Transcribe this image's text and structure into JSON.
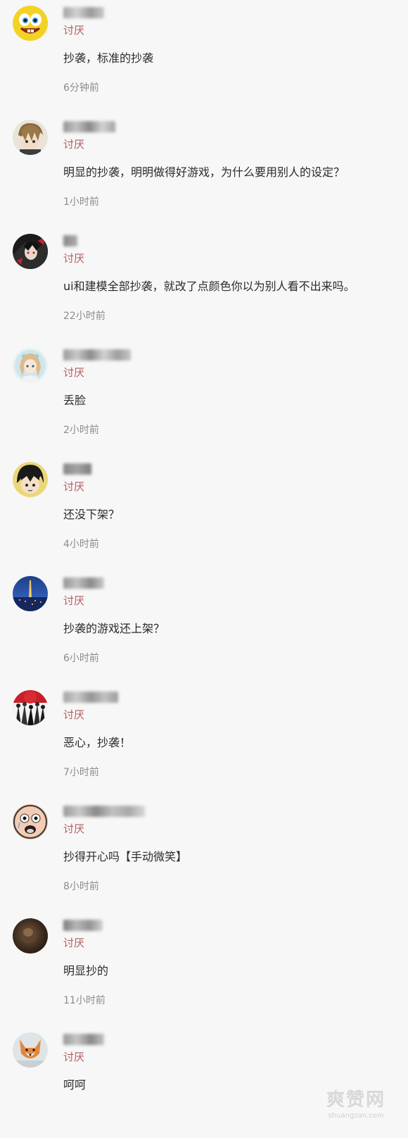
{
  "comments": [
    {
      "tag": "讨厌",
      "text": "抄袭，标准的抄袭",
      "time": "6分钟前",
      "avatar": "spongebob-avatar"
    },
    {
      "tag": "讨厌",
      "text": "明显的抄袭，明明做得好游戏，为什么要用别人的设定？",
      "time": "1小时前",
      "avatar": "anime-boy-avatar"
    },
    {
      "tag": "讨厌",
      "text": "ui和建模全部抄袭，就改了点颜色你以为别人看不出来吗。",
      "time": "22小时前",
      "avatar": "dark-anime-avatar"
    },
    {
      "tag": "讨厌",
      "text": "丢脸",
      "time": "2小时前",
      "avatar": "anime-girl-avatar"
    },
    {
      "tag": "讨厌",
      "text": "还没下架？",
      "time": "4小时前",
      "avatar": "cartoon-face-avatar"
    },
    {
      "tag": "讨厌",
      "text": "抄袭的游戏还上架？",
      "time": "6小时前",
      "avatar": "night-city-avatar"
    },
    {
      "tag": "讨厌",
      "text": "恶心，抄袭！",
      "time": "7小时前",
      "avatar": "crowd-avatar"
    },
    {
      "tag": "讨厌",
      "text": "抄得开心吗【手动微笑】",
      "time": "8小时前",
      "avatar": "scared-face-avatar"
    },
    {
      "tag": "讨厌",
      "text": "明显抄的",
      "time": "11小时前",
      "avatar": "dark-photo-avatar"
    },
    {
      "tag": "讨厌",
      "text": "呵呵",
      "time": "",
      "avatar": "fox-avatar"
    }
  ],
  "colors": {
    "background": "#f7f7f8",
    "tag": "#b35a5a",
    "time": "#8c8c8c",
    "text": "#2b2b2b"
  },
  "watermark": {
    "logo": "爽赞网",
    "url": "shuangzan.com"
  }
}
